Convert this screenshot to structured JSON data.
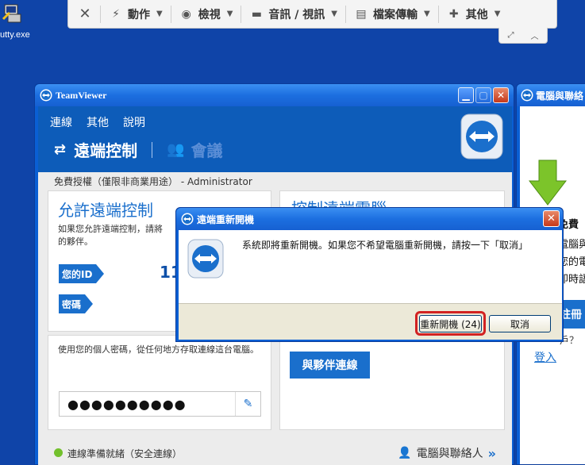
{
  "desktop": {
    "icon_label": "utty.exe"
  },
  "toolbar": {
    "close_label": "✕",
    "menus": [
      {
        "icon": "lightning-icon",
        "glyph": "⚡",
        "label": "動作"
      },
      {
        "icon": "eye-icon",
        "glyph": "◉",
        "label": "檢視"
      },
      {
        "icon": "chat-icon",
        "glyph": "▬",
        "label": "音訊 / 視訊"
      },
      {
        "icon": "file-transfer-icon",
        "glyph": "▤",
        "label": "檔案傳輸"
      },
      {
        "icon": "puzzle-icon",
        "glyph": "✚",
        "label": "其他"
      }
    ]
  },
  "main_window": {
    "title": "TeamViewer",
    "menus": [
      "連線",
      "其他",
      "說明"
    ],
    "mode_active": "遠端控制",
    "mode_inactive": "會議",
    "license": "免費授權（僅限非商業用途） - Administrator",
    "allow_card": {
      "heading": "允許遠端控制",
      "desc_line1": "如果您允許遠端控制，請將",
      "desc_line2": "的夥伴。",
      "id_label": "您的ID",
      "id_value_partial": "11",
      "password_label": "密碼"
    },
    "control_card": {
      "heading_partial": "控制遠端電腦"
    },
    "personal_card": {
      "desc": "使用您的個人密碼，從任何地方存取連線這台電腦。",
      "password_mask": "●●●●●●●●●●"
    },
    "partner_button": "與夥伴連線",
    "status": "連線準備就緒（安全連線）",
    "contacts_label": "電腦與聯絡人"
  },
  "right_window": {
    "title": "電腦與聯絡",
    "heading_partial": "免費",
    "lines": [
      "電腦與",
      "您的電",
      "即時語"
    ],
    "register_partial": "註冊",
    "question_partial": "戶？",
    "login": "登入"
  },
  "dialog": {
    "title": "遠端重新開機",
    "message": "系統即將重新開機。如果您不希望電腦重新開機，請按一下「取消」",
    "reboot_button": "重新開機 (24)",
    "cancel_button": "取消"
  }
}
